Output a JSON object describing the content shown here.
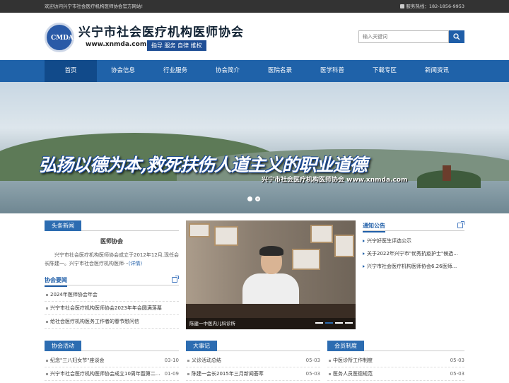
{
  "topbar": {
    "welcome": "欢迎访问兴宁市社会医疗机构医师协会官方网站!",
    "hotline_label": "服务热线：",
    "hotline_number": "182-1856-9953"
  },
  "logo": {
    "emblem_text": "CMDA",
    "title": "兴宁市社会医疗机构医师协会",
    "url": "www.xnmda.com",
    "slogan": "指导 服务 自律 维权"
  },
  "search": {
    "placeholder": "输入关键词"
  },
  "nav": {
    "items": [
      "首页",
      "协会信息",
      "行业服务",
      "协会简介",
      "医院名录",
      "医学科普",
      "下载专区",
      "新闻资讯"
    ],
    "active_index": 0
  },
  "banner": {
    "slogan": "弘扬以德为本,救死扶伤人道主义的职业道德",
    "subtitle": "兴宁市社会医疗机构医师协会 www.xnmda.com"
  },
  "headline": {
    "tab": "头条新闻",
    "title": "医师协会",
    "desc": "兴宁市社会医疗机构医师协会成立于2012年12月,现任会长陈建一。兴宁市社会医疗机构医师···",
    "more": "(详情)"
  },
  "association_news": {
    "title": "协会要闻",
    "items": [
      "2024年医师协会年会",
      "兴宁市社会医疗机构医师协会2023年年会圆满落幕",
      "给社会医疗机构医务工作者的春节慰问信"
    ]
  },
  "photo": {
    "caption": "陈建一中医内儿科诊所",
    "active_slide": 1,
    "slide_count": 4
  },
  "notice": {
    "title": "通知公告",
    "items": [
      "兴宁好医生评选公示",
      "关于2022年兴宁市\"优秀抗疫护士\"候选...",
      "兴宁市社会医疗机构医师协会6.26医师..."
    ]
  },
  "activities": {
    "title": "协会活动",
    "items": [
      {
        "text": "纪念\"三八妇女节\"座谈会",
        "date": "03-10"
      },
      {
        "text": "兴宁市社会医疗机构医师协会成立10周年暨第二...",
        "date": "01-09"
      }
    ]
  },
  "events": {
    "title": "大事记",
    "items": [
      {
        "text": "义诊活动总结",
        "date": "05-03"
      },
      {
        "text": "陈建一会长2015年三月新闻荟萃",
        "date": "05-03"
      }
    ]
  },
  "membership": {
    "title": "会员制度",
    "items": [
      {
        "text": "中医诊所工作制度",
        "date": "05-03"
      },
      {
        "text": "医务人员医德规范",
        "date": "05-03"
      }
    ]
  }
}
